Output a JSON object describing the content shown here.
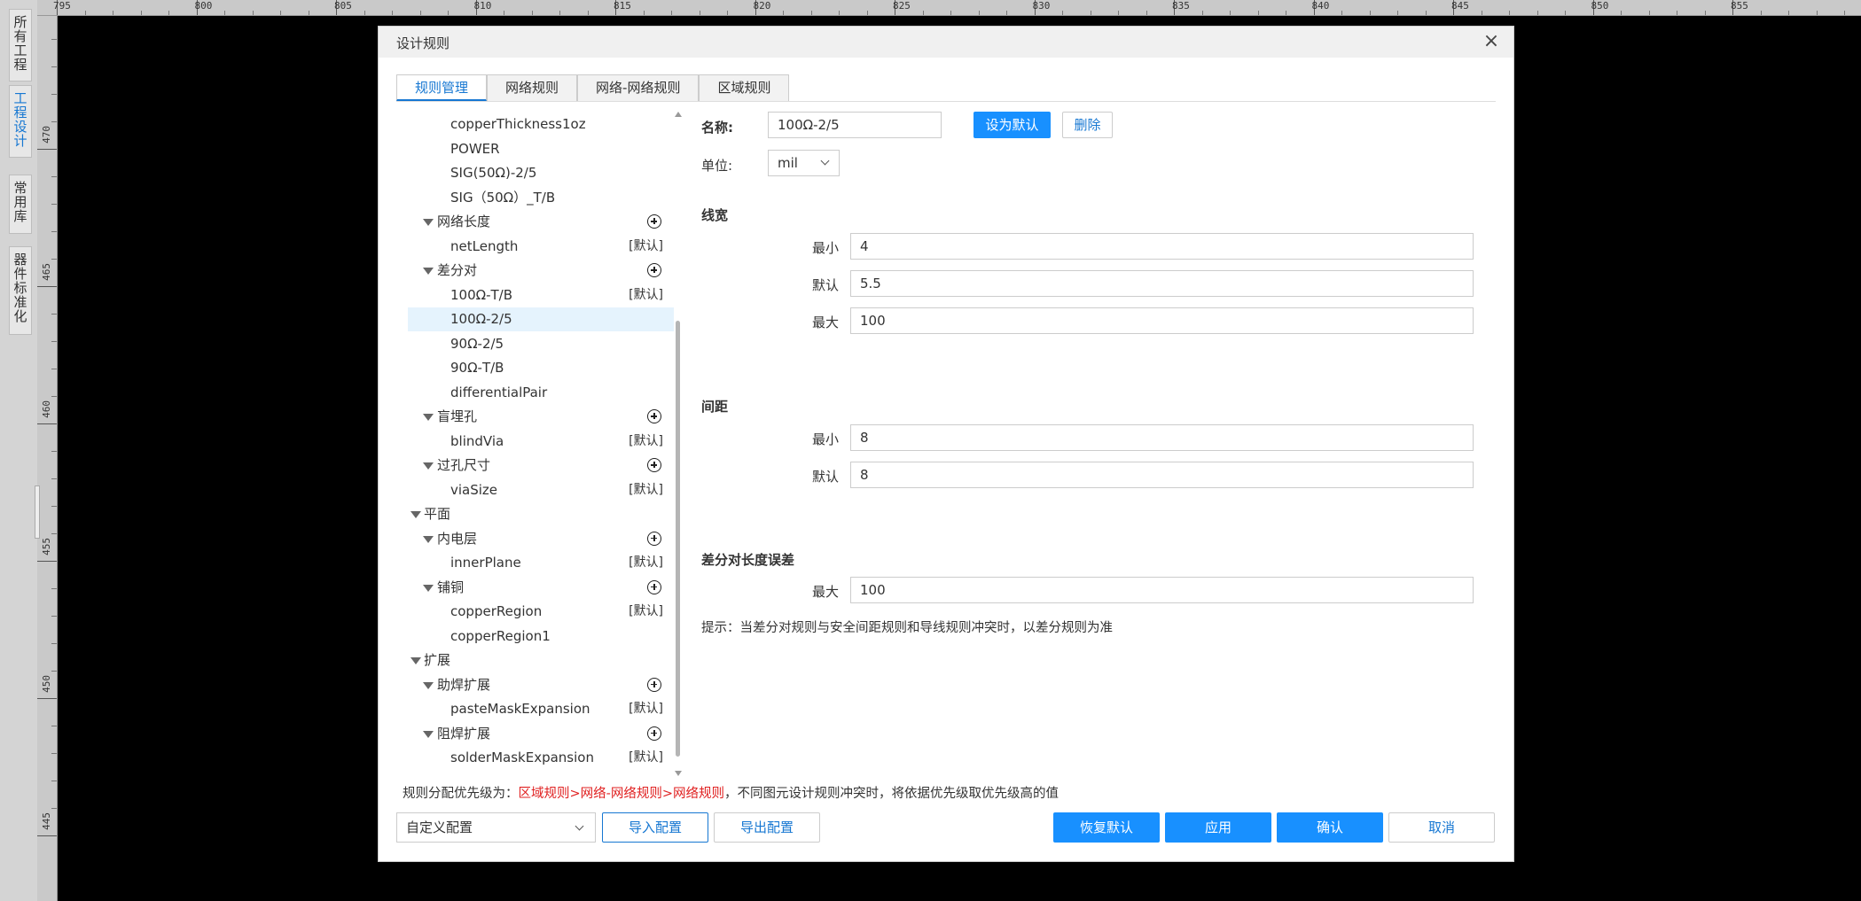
{
  "side_tabs": [
    "所有工程",
    "工程设计",
    "常用库",
    "器件标准化"
  ],
  "ruler": {
    "h_labels": [
      "795",
      "800",
      "805",
      "810",
      "815",
      "820",
      "825",
      "830",
      "835",
      "840",
      "845",
      "850",
      "855"
    ],
    "v_labels": [
      "470",
      "465",
      "460",
      "455",
      "450",
      "445"
    ]
  },
  "dialog": {
    "title": "设计规则",
    "close_icon": "close-icon",
    "tabs": [
      "规则管理",
      "网络规则",
      "网络-网络规则",
      "区域规则"
    ],
    "active_tab": 0
  },
  "tree": [
    {
      "level": 2,
      "label": "copperThickness1oz"
    },
    {
      "level": 2,
      "label": "POWER"
    },
    {
      "level": 2,
      "label": "SIG(50Ω)-2/5"
    },
    {
      "level": 2,
      "label": "SIG（50Ω）_T/B"
    },
    {
      "level": 1,
      "label": "网络长度",
      "expanded": true,
      "add": true
    },
    {
      "level": 2,
      "label": "netLength",
      "default": "[默认]"
    },
    {
      "level": 1,
      "label": "差分对",
      "expanded": true,
      "add": true
    },
    {
      "level": 2,
      "label": "100Ω-T/B",
      "default": "[默认]"
    },
    {
      "level": 2,
      "label": "100Ω-2/5",
      "selected": true
    },
    {
      "level": 2,
      "label": "90Ω-2/5"
    },
    {
      "level": 2,
      "label": "90Ω-T/B"
    },
    {
      "level": 2,
      "label": "differentialPair"
    },
    {
      "level": 1,
      "label": "盲埋孔",
      "expanded": true,
      "add": true
    },
    {
      "level": 2,
      "label": "blindVia",
      "default": "[默认]"
    },
    {
      "level": 1,
      "label": "过孔尺寸",
      "expanded": true,
      "add": true
    },
    {
      "level": 2,
      "label": "viaSize",
      "default": "[默认]"
    },
    {
      "level": 0,
      "label": "平面",
      "expanded": true
    },
    {
      "level": 1,
      "label": "内电层",
      "expanded": true,
      "add": true
    },
    {
      "level": 2,
      "label": "innerPlane",
      "default": "[默认]"
    },
    {
      "level": 1,
      "label": "铺铜",
      "expanded": true,
      "add": true
    },
    {
      "level": 2,
      "label": "copperRegion",
      "default": "[默认]"
    },
    {
      "level": 2,
      "label": "copperRegion1"
    },
    {
      "level": 0,
      "label": "扩展",
      "expanded": true
    },
    {
      "level": 1,
      "label": "助焊扩展",
      "expanded": true,
      "add": true
    },
    {
      "level": 2,
      "label": "pasteMaskExpansion",
      "default": "[默认]"
    },
    {
      "level": 1,
      "label": "阻焊扩展",
      "expanded": true,
      "add": true
    },
    {
      "level": 2,
      "label": "solderMaskExpansion",
      "default": "[默认]"
    }
  ],
  "form": {
    "name_label": "名称:",
    "name_value": "100Ω-2/5",
    "set_default_label": "设为默认",
    "delete_label": "删除",
    "unit_label": "单位:",
    "unit_value": "mil",
    "track_width": {
      "section": "线宽",
      "min_label": "最小",
      "min_value": "4",
      "default_label": "默认",
      "default_value": "5.5",
      "max_label": "最大",
      "max_value": "100"
    },
    "spacing": {
      "section": "间距",
      "min_label": "最小",
      "min_value": "8",
      "default_label": "默认",
      "default_value": "8"
    },
    "length_tolerance": {
      "section": "差分对长度误差",
      "max_label": "最大",
      "max_value": "100"
    },
    "hint": "提示：当差分对规则与安全间距规则和导线规则冲突时，以差分规则为准"
  },
  "footer": {
    "priority_prefix": "规则分配优先级为：",
    "priority_order": "区域规则>网络-网络规则>网络规则",
    "priority_suffix": "，不同图元设计规则冲突时，将依据优先级取优先级高的值",
    "config_value": "自定义配置",
    "import_label": "导入配置",
    "export_label": "导出配置",
    "restore_label": "恢复默认",
    "apply_label": "应用",
    "ok_label": "确认",
    "cancel_label": "取消"
  },
  "colors": {
    "accent": "#1890ff",
    "priority_red": "#e02020",
    "selected_row": "#e5f3fd"
  }
}
